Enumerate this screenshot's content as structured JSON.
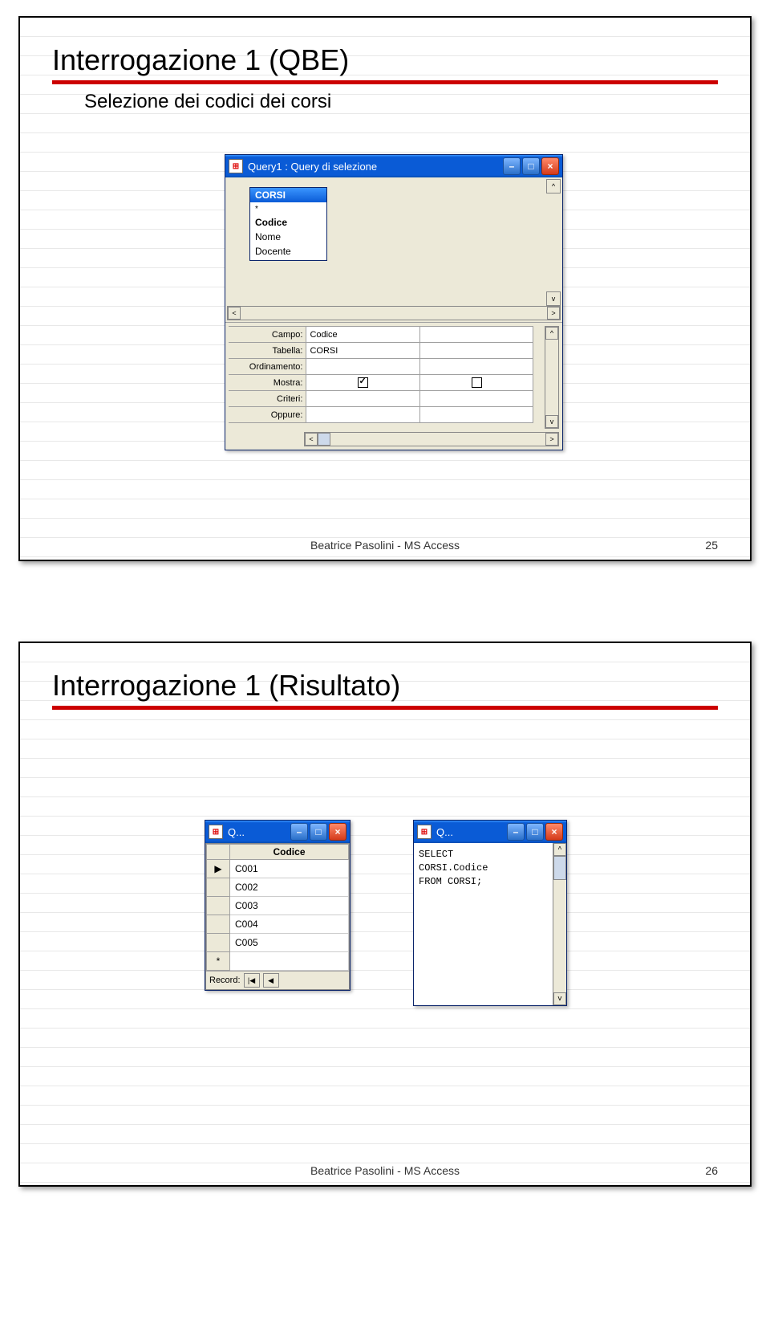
{
  "slide1": {
    "title": "Interrogazione 1 (QBE)",
    "subtitle": "Selezione dei codici dei corsi",
    "footer": "Beatrice Pasolini - MS Access",
    "page": "25",
    "query_window": {
      "title": "Query1 : Query di selezione",
      "table": {
        "name": "CORSI",
        "fields": [
          "*",
          "Codice",
          "Nome",
          "Docente"
        ],
        "bold_index": 1
      },
      "grid": {
        "labels": [
          "Campo:",
          "Tabella:",
          "Ordinamento:",
          "Mostra:",
          "Criteri:",
          "Oppure:"
        ],
        "col1": {
          "campo": "Codice",
          "tabella": "CORSI",
          "mostra": true
        },
        "col2": {
          "mostra": false
        }
      }
    }
  },
  "slide2": {
    "title": "Interrogazione 1 (Risultato)",
    "footer": "Beatrice Pasolini - MS Access",
    "page": "26",
    "result_window": {
      "title": "Q...",
      "header": "Codice",
      "rows": [
        "C001",
        "C002",
        "C003",
        "C004",
        "C005"
      ],
      "record_label": "Record:"
    },
    "sql_window": {
      "title": "Q...",
      "sql": [
        "SELECT",
        "CORSI.Codice",
        "FROM CORSI;"
      ]
    }
  }
}
